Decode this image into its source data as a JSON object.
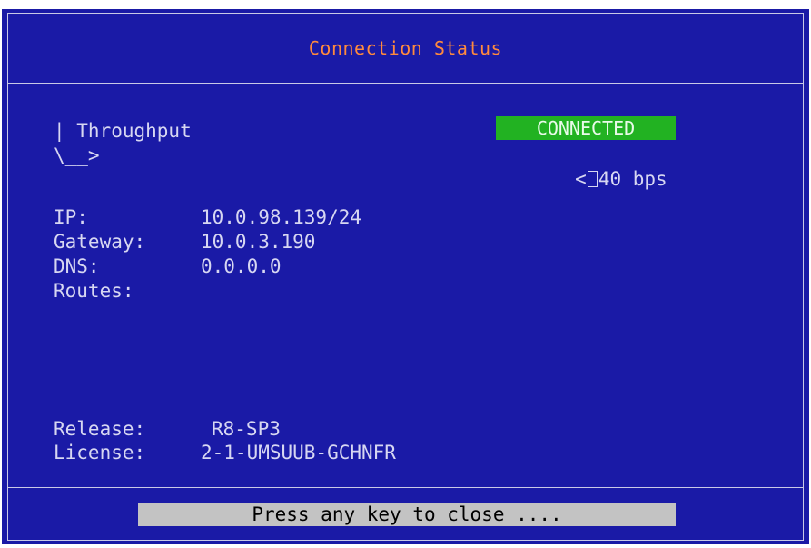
{
  "window": {
    "title": "Connection Status"
  },
  "graph": {
    "label_line": "| Throughput",
    "axis_line": "\\__>"
  },
  "status": {
    "badge": "CONNECTED",
    "rate_prefix": "<",
    "rate_value": "40 bps"
  },
  "network": {
    "ip_label": "IP:",
    "ip_value": "10.0.98.139/24",
    "gateway_label": "Gateway:",
    "gateway_value": "10.0.3.190",
    "dns_label": "DNS:",
    "dns_value": "0.0.0.0",
    "routes_label": "Routes:"
  },
  "info": {
    "release_label": "Release:",
    "release_value": "R8-SP3",
    "license_label": "License:",
    "license_value": "2-1-UMSUUB-GCHNFR"
  },
  "footer": {
    "close_label": "Press any key to close ...."
  },
  "colors": {
    "background": "#1a1aa6",
    "title": "#ff8a3d",
    "text": "#d7d7f2",
    "badge": "#22b222",
    "close_bar": "#c3c3c3"
  }
}
